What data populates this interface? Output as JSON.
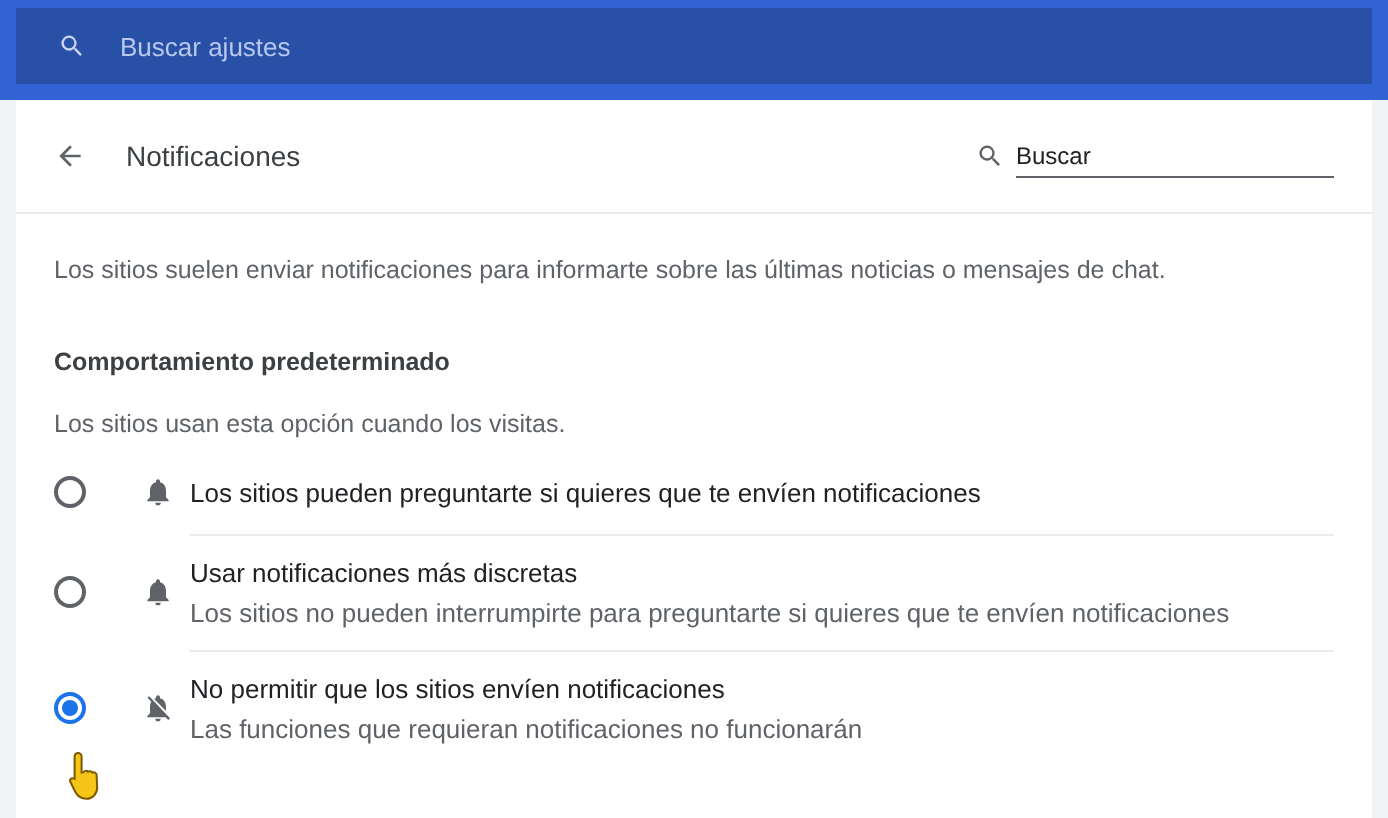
{
  "top_search": {
    "placeholder": "Buscar ajustes"
  },
  "header": {
    "title": "Notificaciones",
    "search": {
      "value": "Buscar"
    }
  },
  "description": "Los sitios suelen enviar notificaciones para informarte sobre las últimas noticias o mensajes de chat.",
  "section": {
    "title": "Comportamiento predeterminado",
    "subtitle": "Los sitios usan esta opción cuando los visitas."
  },
  "options": [
    {
      "label": "Los sitios pueden preguntarte si quieres que te envíen notificaciones",
      "kind": "allowed",
      "selected": false
    },
    {
      "label": "Usar notificaciones más discretas",
      "sublabel": "Los sitios no pueden interrumpirte para preguntarte si quieres que te envíen notificaciones",
      "kind": "allowed",
      "selected": false
    },
    {
      "label": "No permitir que los sitios envíen notificaciones",
      "sublabel": "Las funciones que requieran notificaciones no funcionarán",
      "kind": "blocked",
      "selected": true
    }
  ]
}
